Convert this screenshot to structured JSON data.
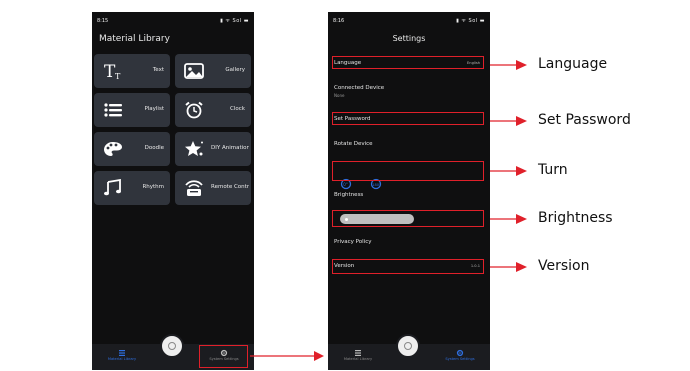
{
  "library_screen": {
    "status": {
      "time": "8:15",
      "icons": "▮ ᯤ Sol ▬"
    },
    "title": "Material Library",
    "tiles": [
      {
        "label": "Text",
        "icon": "text-icon"
      },
      {
        "label": "Gallery",
        "icon": "gallery-icon"
      },
      {
        "label": "Playlist",
        "icon": "playlist-icon"
      },
      {
        "label": "Clock",
        "icon": "alarm-clock-icon"
      },
      {
        "label": "Doodle",
        "icon": "palette-icon"
      },
      {
        "label": "DIY Animation",
        "icon": "sparkle-star-icon"
      },
      {
        "label": "Rhythm",
        "icon": "music-note-icon"
      },
      {
        "label": "Remote Control",
        "icon": "remote-icon"
      }
    ],
    "tabbar": {
      "left_label": "Material Library",
      "right_label": "System Settings"
    }
  },
  "settings_screen": {
    "status": {
      "time": "8:16",
      "icons": "▮ ᯤ Sol ▬"
    },
    "title": "Settings",
    "language": {
      "label": "Language",
      "value": "English"
    },
    "connected_device": {
      "label": "Connected Device",
      "value": "None"
    },
    "set_password": {
      "label": "Set Password"
    },
    "rotate_device": {
      "label": "Rotate Device"
    },
    "brightness": {
      "label": "Brightness"
    },
    "privacy_policy": {
      "label": "Privacy Policy"
    },
    "version": {
      "label": "Version",
      "value": "1.0.1"
    },
    "tabbar": {
      "left_label": "Material Library",
      "right_label": "System Settings"
    }
  },
  "callouts": {
    "language": "Language",
    "set_password": "Set Password",
    "turn": "Turn",
    "brightness": "Brightness",
    "version": "Version"
  },
  "colors": {
    "highlight": "#e0202a",
    "accent": "#2f6fe0",
    "tile": "#30343c",
    "screen_bg": "#0f0f10"
  }
}
